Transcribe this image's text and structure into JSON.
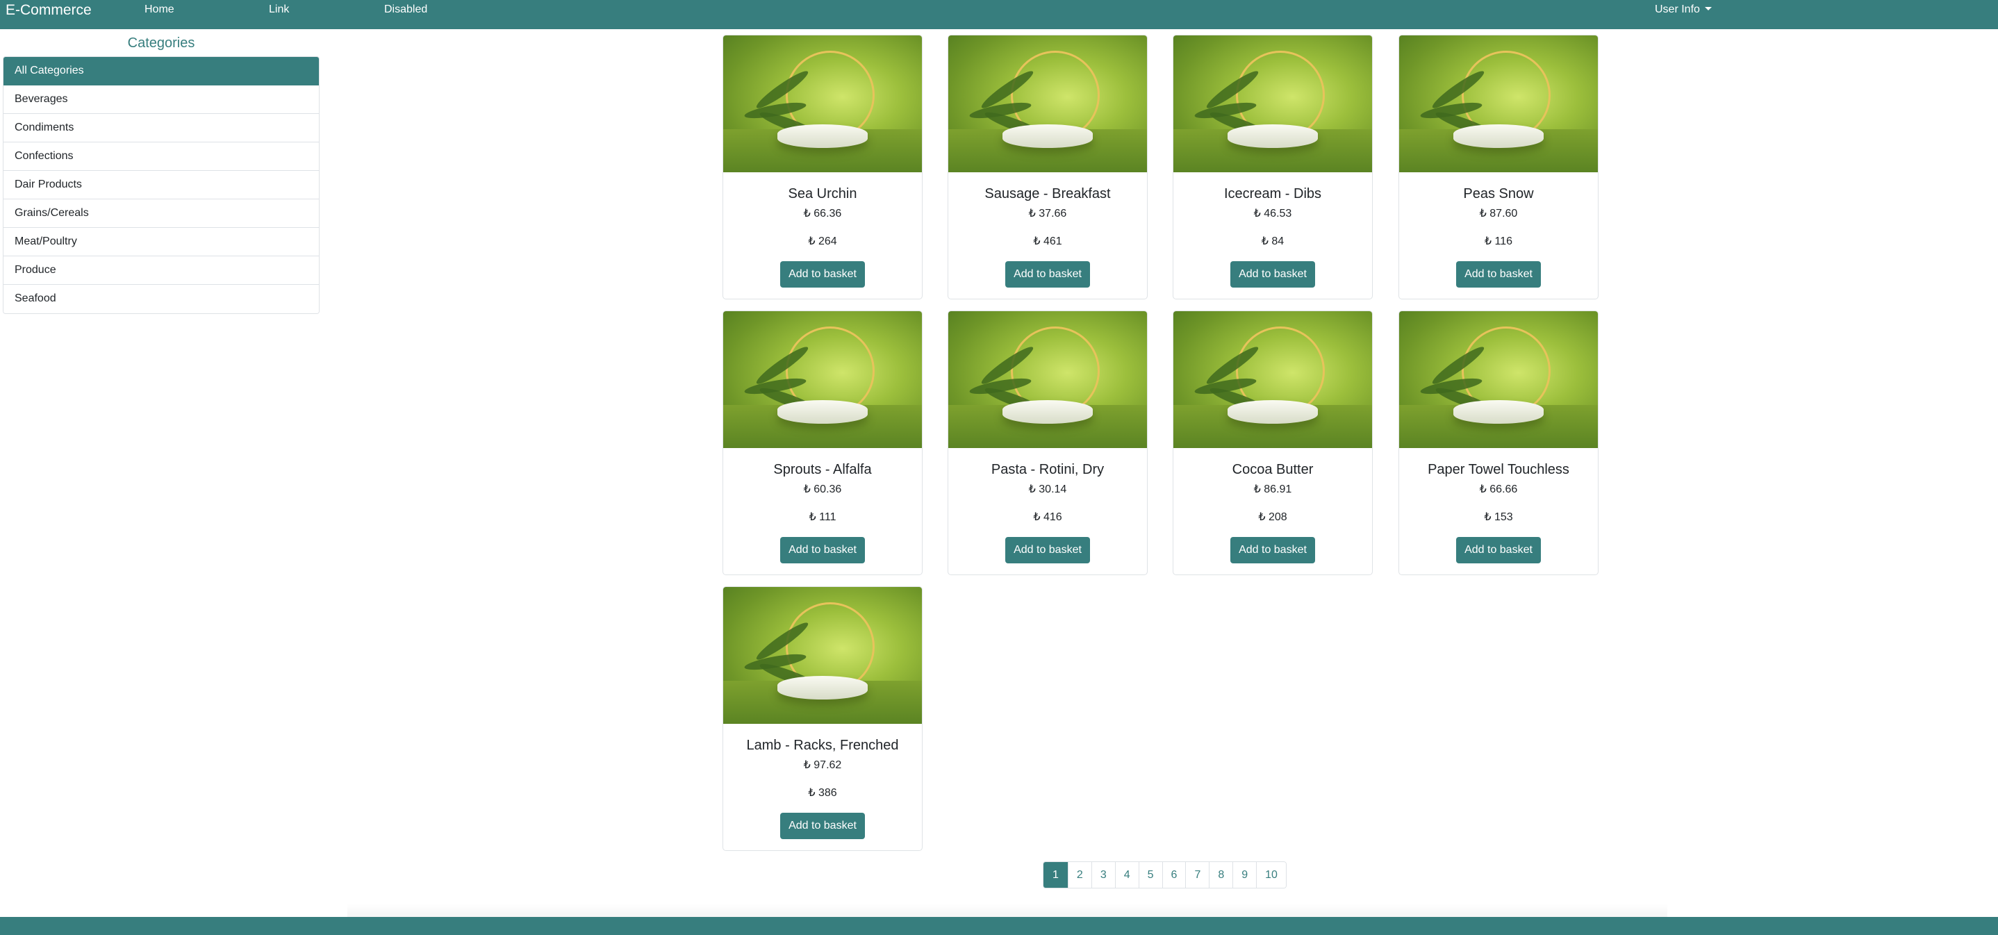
{
  "navbar": {
    "brand": "E-Commerce",
    "links": [
      "Home",
      "Link",
      "Disabled"
    ],
    "user_menu": "User Info"
  },
  "sidebar": {
    "title": "Categories",
    "items": [
      "All Categories",
      "Beverages",
      "Condiments",
      "Confections",
      "Dair Products",
      "Grains/Cereals",
      "Meat/Poultry",
      "Produce",
      "Seafood"
    ],
    "active_index": 0
  },
  "products": [
    {
      "name": "Sea Urchin",
      "price": "₺ 66.36",
      "stock": "₺ 264",
      "button": "Add to basket"
    },
    {
      "name": "Sausage - Breakfast",
      "price": "₺ 37.66",
      "stock": "₺ 461",
      "button": "Add to basket"
    },
    {
      "name": "Icecream - Dibs",
      "price": "₺ 46.53",
      "stock": "₺ 84",
      "button": "Add to basket"
    },
    {
      "name": "Peas Snow",
      "price": "₺ 87.60",
      "stock": "₺ 116",
      "button": "Add to basket"
    },
    {
      "name": "Sprouts - Alfalfa",
      "price": "₺ 60.36",
      "stock": "₺ 111",
      "button": "Add to basket"
    },
    {
      "name": "Pasta - Rotini, Dry",
      "price": "₺ 30.14",
      "stock": "₺ 416",
      "button": "Add to basket"
    },
    {
      "name": "Cocoa Butter",
      "price": "₺ 86.91",
      "stock": "₺ 208",
      "button": "Add to basket"
    },
    {
      "name": "Paper Towel Touchless",
      "price": "₺ 66.66",
      "stock": "₺ 153",
      "button": "Add to basket"
    },
    {
      "name": "Lamb - Racks, Frenched",
      "price": "₺ 97.62",
      "stock": "₺ 386",
      "button": "Add to basket"
    }
  ],
  "pagination": {
    "pages": [
      "1",
      "2",
      "3",
      "4",
      "5",
      "6",
      "7",
      "8",
      "9",
      "10"
    ],
    "active": "1"
  },
  "colors": {
    "primary": "#377e7e",
    "text": "#212529",
    "border": "#dee2e6"
  }
}
